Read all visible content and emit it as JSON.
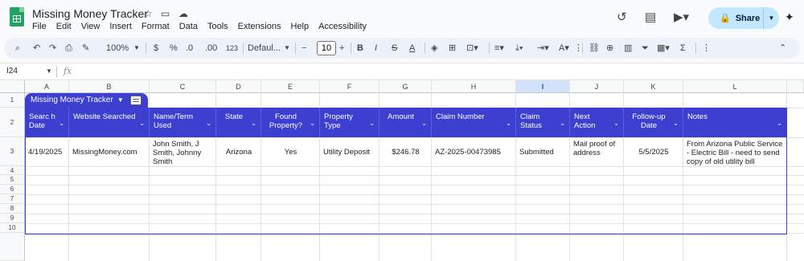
{
  "document": {
    "title": "Missing Money Tracker"
  },
  "menu": [
    "File",
    "Edit",
    "View",
    "Insert",
    "Format",
    "Data",
    "Tools",
    "Extensions",
    "Help",
    "Accessibility"
  ],
  "header": {
    "share_label": "Share"
  },
  "toolbar": {
    "zoom": "100%",
    "currency": "$",
    "percent": "%",
    "decrease_decimal": ".0",
    "increase_decimal": ".00",
    "number_format": "123",
    "font": "Defaul...",
    "font_size": "10"
  },
  "formula_bar": {
    "cell_ref": "I24",
    "fx": "fx"
  },
  "columns": [
    "A",
    "B",
    "C",
    "D",
    "E",
    "F",
    "G",
    "H",
    "I",
    "J",
    "K",
    "L"
  ],
  "rows": [
    "1",
    "2",
    "3",
    "4",
    "5",
    "6",
    "7",
    "8",
    "9",
    "10"
  ],
  "table": {
    "name": "Missing Money Tracker",
    "headers": [
      "Searc h Date",
      "Website Searched",
      "Name/Term Used",
      "State",
      "Found Property?",
      "Property Type",
      "Amount",
      "Claim Number",
      "Claim Status",
      "Next Action",
      "Follow-up Date",
      "Notes"
    ],
    "row": [
      "4/19/2025",
      "MissingMoney.com",
      "John Smith, J Smith, Johnny Smith",
      "Arizona",
      "Yes",
      "Utility Deposit",
      "$246.78",
      "AZ-2025-00473985",
      "Submitted",
      "Mail proof of address",
      "5/5/2025",
      "From Arizona Public Service - Electric Bill - need to send copy of old utility bill"
    ]
  },
  "colors": {
    "table_header": "#3c3fd0",
    "share_bg": "#c2e7ff",
    "selected_column": "#d3e3fd"
  }
}
